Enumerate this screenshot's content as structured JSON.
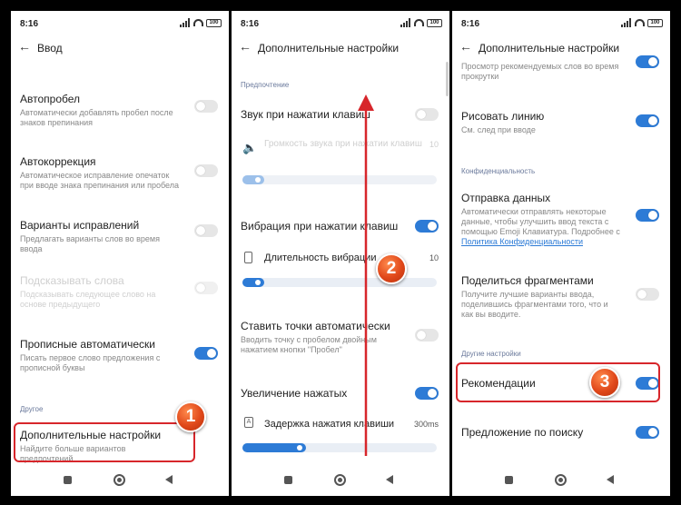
{
  "status": {
    "time": "8:16",
    "battery": "100"
  },
  "panel1": {
    "title": "Ввод",
    "rows": [
      {
        "title": "Автопробел",
        "desc": "Автоматически добавлять пробел после знаков препинания"
      },
      {
        "title": "Автокоррекция",
        "desc": "Автоматическое исправление опечаток при вводе знака препинания или пробела"
      },
      {
        "title": "Варианты исправлений",
        "desc": "Предлагать варианты слов во время ввода"
      },
      {
        "title": "Подсказывать слова",
        "desc": "Подсказывать следующее слово на основе предыдущего"
      },
      {
        "title": "Прописные автоматически",
        "desc": "Писать первое слово предложения с прописной буквы"
      }
    ],
    "section": "Другое",
    "more_title": "Дополнительные настройки",
    "more_desc": "Найдите больше вариантов предпочтений",
    "badge": "1"
  },
  "panel2": {
    "title": "Дополнительные настройки",
    "section": "Предпочтение",
    "sound": "Звук при нажатии клавиш",
    "sound_volume": "Громкость звука при нажатии клавиш",
    "sound_volume_value": "10",
    "vibration": "Вибрация при нажатии клавиш",
    "vibration_duration": "Длительность вибрации",
    "vibration_value": "10",
    "autoperiod_title": "Ставить точки автоматически",
    "autoperiod_desc": "Вводить точку с пробелом двойным нажатием кнопки \"Пробел\"",
    "zoom": "Увеличение нажатых",
    "key_delay": "Задержка нажатия клавиши",
    "key_delay_value": "300ms",
    "key_icon": "A",
    "badge": "2"
  },
  "panel3": {
    "title": "Дополнительные настройки",
    "prev_desc_1": "Просмотр рекомендуемых слов во время",
    "prev_desc_2": "прокрутки",
    "draw_title": "Рисовать линию",
    "draw_desc": "См. след при вводе",
    "section_privacy": "Конфиденциальность",
    "send_title": "Отправка данных",
    "send_desc": "Автоматически отправлять некоторые данные, чтобы улучшить ввод текста с помощью Emoji Клавиатура. Подробнее с",
    "send_link": "Политика Конфиденциальности",
    "share_title": "Поделиться фрагментами",
    "share_desc": "Получите лучшие варианты ввода, поделившись фрагментами того, что и как вы вводите.",
    "section_other": "Другие настройки",
    "rec_title": "Рекомендации",
    "search_title": "Предложение по поиску",
    "badge": "3"
  },
  "colors": {
    "accent": "#2d7bd6",
    "highlight": "#d7262b",
    "badge": "#e0481a"
  }
}
